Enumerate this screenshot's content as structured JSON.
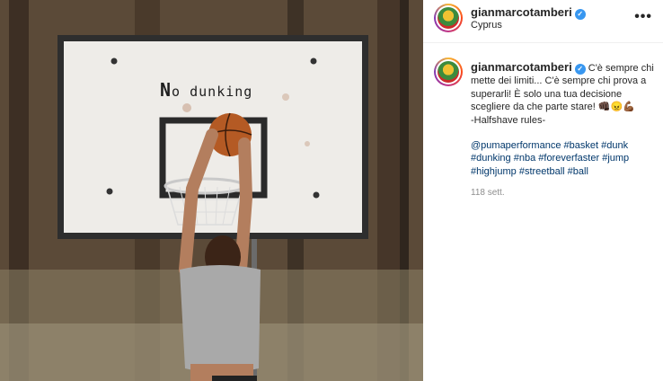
{
  "photo": {
    "backboard_text_big": "N",
    "backboard_text_rest": "o dunking"
  },
  "header": {
    "username": "gianmarcotamberi",
    "verified_mark": "✓",
    "location": "Cyprus",
    "more_icon": "•••"
  },
  "caption": {
    "username": "gianmarcotamberi",
    "verified_mark": "✓",
    "text": "C'è sempre chi mette dei limiti... C'è sempre chi prova a superarli! È solo una tua decisione scegliere da che parte stare!",
    "emoji": "👊🏿😠💪🏾",
    "signoff": "-Halfshave rules-",
    "hashtags": [
      "@pumaperformance",
      "#basket",
      "#dunk",
      "#dunking",
      "#nba",
      "#foreverfaster",
      "#jump",
      "#highjump",
      "#streetball",
      "#ball"
    ],
    "timestamp": "118 sett."
  }
}
